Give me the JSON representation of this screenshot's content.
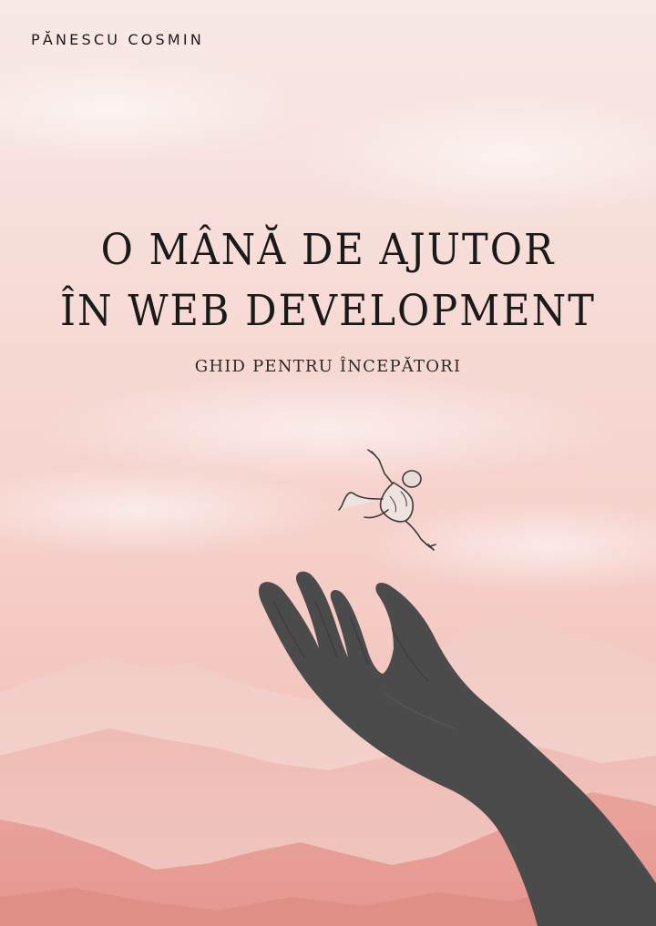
{
  "cover": {
    "author": "PĂNESCU COSMIN",
    "title_line_1": "O MÂNĂ DE AJUTOR",
    "title_line_2": "ÎN WEB DEVELOPMENT",
    "subtitle": "GHID PENTRU ÎNCEPĂTORI"
  },
  "colors": {
    "sky_top": "#f8e9e6",
    "sky_bottom": "#eeb2aa",
    "mountain_far": "#f0c4be",
    "mountain_mid": "#eab0a9",
    "mountain_near": "#e59b93",
    "hand": "#4a4a4a",
    "text": "#1a1a1a"
  },
  "icons": {
    "figure": "falling-figure-illustration",
    "hand": "open-hand-illustration"
  }
}
